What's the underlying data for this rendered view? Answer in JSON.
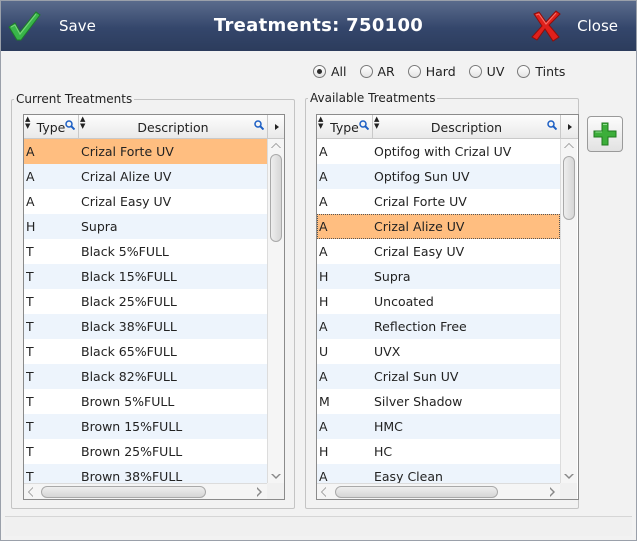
{
  "window": {
    "title": "Treatments: 750100",
    "save_label": "Save",
    "close_label": "Close"
  },
  "filters": [
    {
      "label": "All",
      "selected": true
    },
    {
      "label": "AR",
      "selected": false
    },
    {
      "label": "Hard",
      "selected": false
    },
    {
      "label": "UV",
      "selected": false
    },
    {
      "label": "Tints",
      "selected": false
    }
  ],
  "current": {
    "title": "Current Treatments",
    "col_type": "Type",
    "col_desc": "Description",
    "rows": [
      [
        "A",
        "Crizal Forte UV"
      ],
      [
        "A",
        "Crizal Alize UV"
      ],
      [
        "A",
        "Crizal Easy UV"
      ],
      [
        "H",
        "Supra"
      ],
      [
        "T",
        "Black 5%FULL"
      ],
      [
        "T",
        "Black 15%FULL"
      ],
      [
        "T",
        "Black 25%FULL"
      ],
      [
        "T",
        "Black 38%FULL"
      ],
      [
        "T",
        "Black 65%FULL"
      ],
      [
        "T",
        "Black 82%FULL"
      ],
      [
        "T",
        "Brown 5%FULL"
      ],
      [
        "T",
        "Brown 15%FULL"
      ],
      [
        "T",
        "Brown 25%FULL"
      ],
      [
        "T",
        "Brown 38%FULL"
      ]
    ],
    "selected_index": 0
  },
  "available": {
    "title": "Available Treatments",
    "col_type": "Type",
    "col_desc": "Description",
    "rows": [
      [
        "A",
        "Optifog with Crizal UV"
      ],
      [
        "A",
        "Optifog Sun UV"
      ],
      [
        "A",
        "Crizal Forte UV"
      ],
      [
        "A",
        "Crizal Alize UV"
      ],
      [
        "A",
        "Crizal Easy UV"
      ],
      [
        "H",
        "Supra"
      ],
      [
        "H",
        "Uncoated"
      ],
      [
        "A",
        "Reflection Free"
      ],
      [
        "U",
        "UVX"
      ],
      [
        "A",
        "Crizal Sun UV"
      ],
      [
        "M",
        "Silver Shadow"
      ],
      [
        "A",
        "HMC"
      ],
      [
        "H",
        "HC"
      ],
      [
        "A",
        "Easy Clean"
      ]
    ],
    "selected_index": 3
  },
  "colors": {
    "selection": "#ffbe80",
    "row_alt": "#edf4fc",
    "titlebar": "#34466b",
    "check_green": "#39b54a",
    "close_red": "#e0201b",
    "plus_green": "#3cae3a"
  },
  "icons": {
    "save": "checkmark-icon",
    "close": "x-mark-icon",
    "add": "plus-icon",
    "search": "magnifier-icon"
  }
}
